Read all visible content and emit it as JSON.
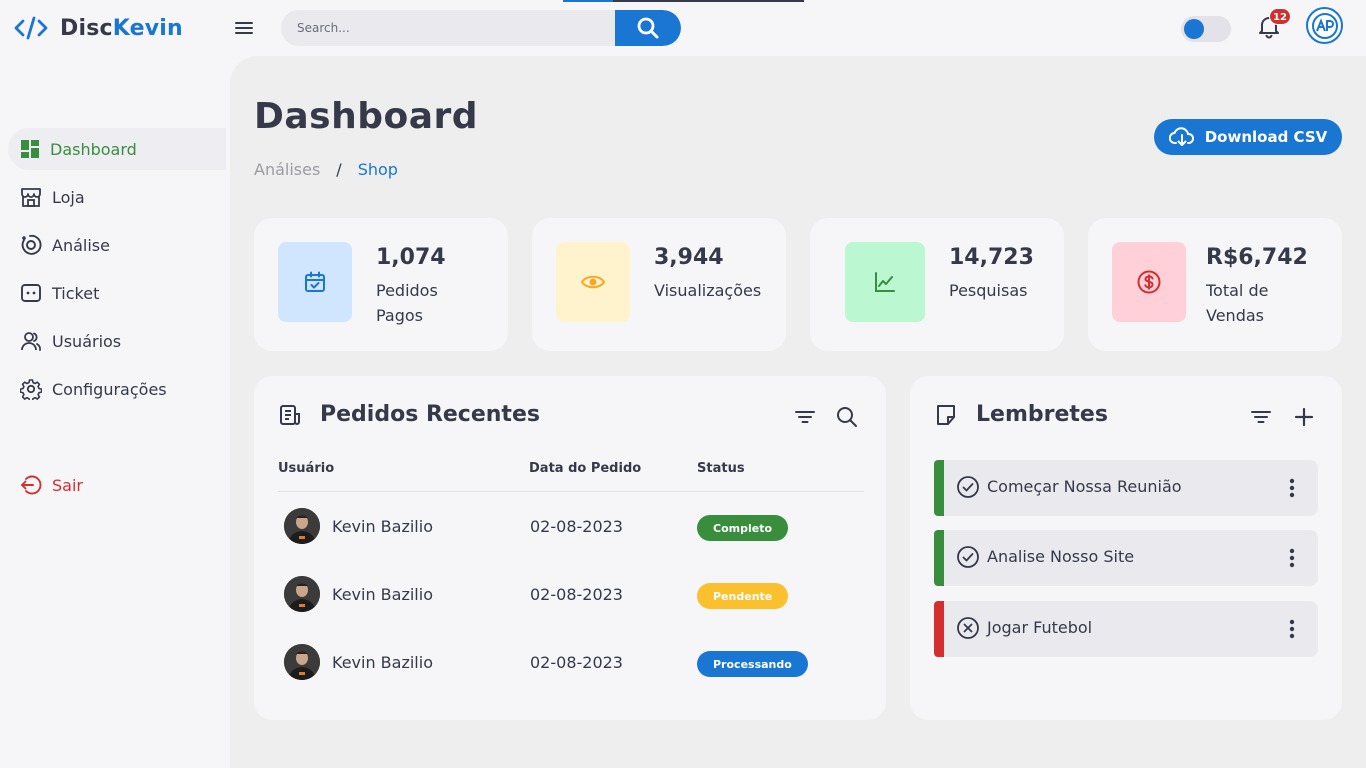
{
  "brand": {
    "part1": "Disc",
    "part2": "Kevin"
  },
  "search": {
    "placeholder": "Search..."
  },
  "notifications": {
    "count": "12"
  },
  "sidebar": {
    "items": [
      {
        "label": "Dashboard",
        "icon": "dashboard-icon"
      },
      {
        "label": "Loja",
        "icon": "store-icon"
      },
      {
        "label": "Análise",
        "icon": "analytics-icon"
      },
      {
        "label": "Ticket",
        "icon": "ticket-icon"
      },
      {
        "label": "Usuários",
        "icon": "users-icon"
      },
      {
        "label": "Configurações",
        "icon": "gear-icon"
      }
    ],
    "logout": "Sair"
  },
  "header": {
    "title": "Dashboard",
    "breadcrumb": [
      "Análises",
      "Shop"
    ],
    "download_label": "Download CSV"
  },
  "stats": [
    {
      "value": "1,074",
      "label_line1": "Pedidos",
      "label_line2": "Pagos",
      "icon": "calendar-check-icon",
      "color": "#1976d2",
      "bg": "#d0e6ff"
    },
    {
      "value": "3,944",
      "label_line1": "Visualizações",
      "label_line2": "",
      "icon": "eye-icon",
      "color": "#f9a825",
      "bg": "#fff3cd"
    },
    {
      "value": "14,723",
      "label_line1": "Pesquisas",
      "label_line2": "",
      "icon": "line-chart-icon",
      "color": "#388e3c",
      "bg": "#bbf7d0"
    },
    {
      "value": "R$6,742",
      "label_line1": "Total de",
      "label_line2": "Vendas",
      "icon": "dollar-icon",
      "color": "#d32f2f",
      "bg": "#ffd0d8"
    }
  ],
  "orders": {
    "title": "Pedidos Recentes",
    "columns": [
      "Usuário",
      "Data do Pedido",
      "Status"
    ],
    "rows": [
      {
        "user": "Kevin Bazilio",
        "date": "02-08-2023",
        "status": "Completo",
        "status_color": "#388e3c"
      },
      {
        "user": "Kevin Bazilio",
        "date": "02-08-2023",
        "status": "Pendente",
        "status_color": "#fbc02d"
      },
      {
        "user": "Kevin Bazilio",
        "date": "02-08-2023",
        "status": "Processando",
        "status_color": "#1976d2"
      }
    ]
  },
  "reminders": {
    "title": "Lembretes",
    "items": [
      {
        "text": "Começar Nossa Reunião",
        "state": "done",
        "color": "#388e3c"
      },
      {
        "text": "Analise Nosso Site",
        "state": "done",
        "color": "#388e3c"
      },
      {
        "text": "Jogar Futebol",
        "state": "cancelled",
        "color": "#d32f2f"
      }
    ]
  },
  "colors": {
    "accent": "#1976d2",
    "success": "#388e3c",
    "warning": "#fbc02d",
    "danger": "#d32f2f",
    "text": "#363949"
  }
}
